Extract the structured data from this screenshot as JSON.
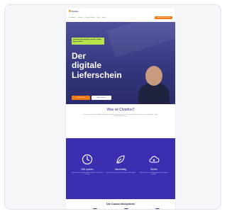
{
  "header": {
    "logo": "Cudoo"
  },
  "nav": {
    "items": [
      "Funktionen",
      "Vorteile",
      "Preise & Pakete",
      "Hilfe",
      "Login"
    ],
    "cta": "Jetzt kostenlos testen"
  },
  "hero": {
    "badge": "Lieferscheine papierlos mit der Cudoo App erstellen",
    "title": "Der\ndigitale\nLieferschein",
    "primary_button": "Jetzt testen",
    "secondary_button": "Mehr erfahren"
  },
  "intro": {
    "title": "Was ist Cloudoo?",
    "text": "Cudoo ist die Lösung für Ihre digitalen Lieferscheine. Erstellen, unterschreiben und versenden Sie Lieferscheine direkt vor Ort beim Kunden – einfach, schnell und ohne Papier."
  },
  "features": [
    {
      "icon": "clock-icon",
      "title": "Zeit sparen",
      "text": "Lieferscheine in Sekunden erstellen und direkt an den Kunden versenden."
    },
    {
      "icon": "leaf-icon",
      "title": "Nachhaltig",
      "text": "Kein Papier mehr nötig – gut für die Umwelt und Ihr Budget."
    },
    {
      "icon": "cloud-icon",
      "title": "Sicher",
      "text": "Alle Daten sicher in der Cloud gespeichert und jederzeit abrufbar."
    }
  ],
  "bottom": {
    "title": "Die Cudoo ökosystem"
  }
}
